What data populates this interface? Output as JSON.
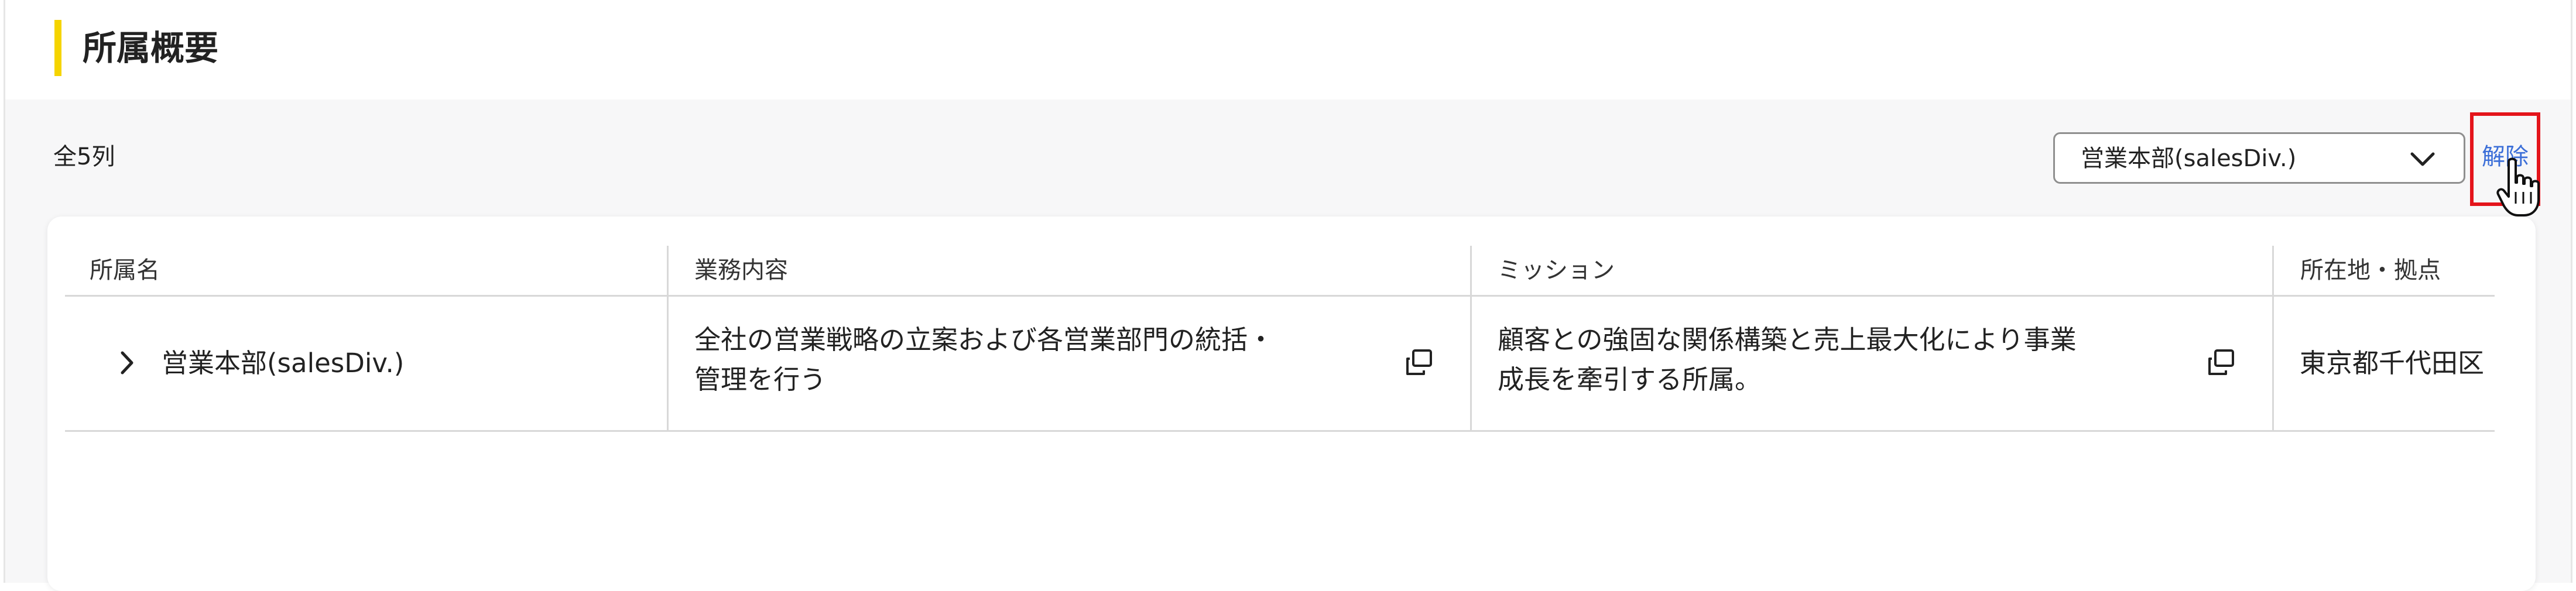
{
  "section": {
    "title": "所属概要"
  },
  "toolbar": {
    "count_label": "全5列",
    "filter_select": {
      "value": "営業本部(salesDiv.)",
      "icon": "chevron-down-icon"
    },
    "reset_label": "解除"
  },
  "table": {
    "columns": [
      "所属名",
      "業務内容",
      "ミッション",
      "所在地・拠点"
    ],
    "rows": [
      {
        "name": "営業本部(salesDiv.)",
        "business_line1": "全社の営業戦略の立案および各営業部門の統括・",
        "business_line2": "管理を行う",
        "mission_line1": "顧客との強固な関係構築と売上最大化により事業",
        "mission_line2": "成長を牽引する所属。",
        "location": "東京都千代田区"
      }
    ]
  },
  "colors": {
    "accent_yellow": "#f5d400",
    "link_blue": "#3c6fd8",
    "highlight_red": "#e4141b",
    "background": "#f7f7f8"
  }
}
